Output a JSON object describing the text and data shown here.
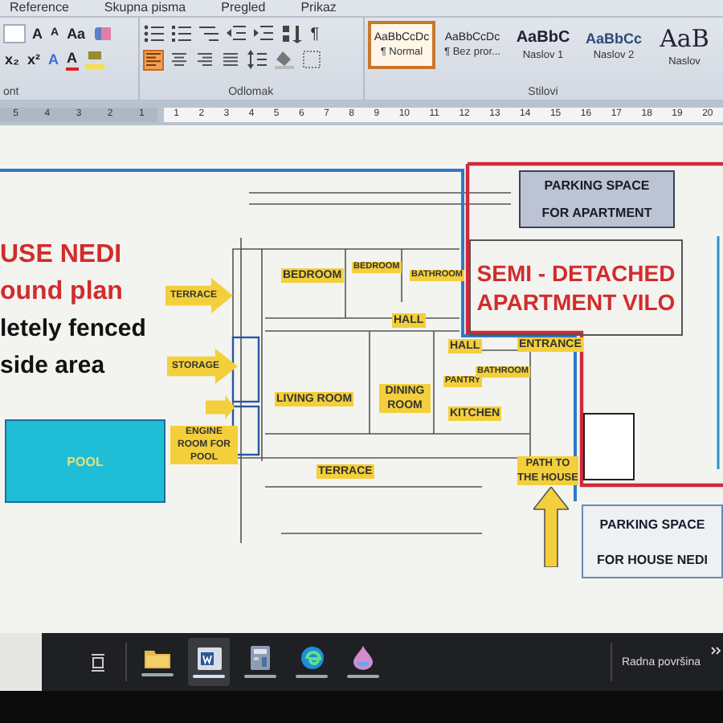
{
  "ribbon": {
    "tabs": [
      "Reference",
      "Skupna pisma",
      "Pregled",
      "Prikaz"
    ],
    "font_buttons": [
      {
        "label": "A",
        "kind": "grow"
      },
      {
        "label": "A",
        "kind": "shrink"
      },
      {
        "label": "Aa",
        "kind": "case"
      },
      {
        "label": "x₂",
        "kind": "sub"
      },
      {
        "label": "x²",
        "kind": "sup"
      },
      {
        "label": "A",
        "kind": "effects"
      },
      {
        "label": "A",
        "kind": "color"
      }
    ],
    "pilcrow": "¶",
    "align_buttons": [
      {
        "selected": true
      },
      {
        "selected": false
      },
      {
        "selected": false
      },
      {
        "selected": false
      }
    ],
    "groups": [
      "ont",
      "Odlomak",
      "Stilovi"
    ],
    "styles": [
      {
        "sample": "AaBbCcDc",
        "name": "¶ Normal",
        "selected": true,
        "kind": "body"
      },
      {
        "sample": "AaBbCcDc",
        "name": "¶ Bez pror...",
        "selected": false,
        "kind": "body"
      },
      {
        "sample": "AaBbC",
        "name": "Naslov 1",
        "selected": false,
        "kind": "heading"
      },
      {
        "sample": "AaBbCc",
        "name": "Naslov 2",
        "selected": false,
        "kind": "heading2"
      },
      {
        "sample": "AaB",
        "name": "Naslov",
        "selected": false,
        "kind": "title"
      }
    ]
  },
  "ruler": {
    "left_marks": [
      "5",
      "4",
      "3",
      "2",
      "1"
    ],
    "right_marks": [
      "1",
      "2",
      "3",
      "4",
      "5",
      "6",
      "7",
      "8",
      "9",
      "10",
      "11",
      "12",
      "13",
      "14",
      "15",
      "16",
      "17",
      "18",
      "19",
      "20"
    ]
  },
  "document": {
    "heading": [
      {
        "text": "USE NEDI",
        "kind": "red"
      },
      {
        "text": "ound plan",
        "kind": "red"
      },
      {
        "text": "letely fenced",
        "kind": "black"
      },
      {
        "text": "side area",
        "kind": "black"
      }
    ],
    "pool": "POOL",
    "arrows": [
      {
        "label": "TERRACE",
        "kind": "inside"
      },
      {
        "label": "STORAGE",
        "kind": "inside"
      },
      {
        "label": "ENGINE ROOM FOR POOL",
        "kind": "below"
      }
    ],
    "rooms": [
      "BEDROOM",
      "BEDROOM",
      "BATHROOM",
      "HALL",
      "HALL",
      "ENTRANCE",
      "LIVING ROOM",
      "DINING ROOM",
      "PANTRY",
      "BATHROOM",
      "KITCHEN",
      "TERRACE"
    ],
    "path_label": "PATH TO THE HOUSE",
    "semi_detached": [
      "SEMI - DETACHED",
      "APARTMENT VILO"
    ],
    "parking": [
      {
        "lines": [
          "PARKING SPACE",
          "FOR APARTMENT"
        ],
        "kind": "dark"
      },
      {
        "lines": [
          "PARKING SPACE",
          "FOR HOUSE NEDI"
        ],
        "kind": "light"
      }
    ]
  },
  "taskbar": {
    "apps": [
      {
        "kind": "folder",
        "selected": false
      },
      {
        "kind": "word",
        "selected": true
      },
      {
        "kind": "calculator",
        "selected": false
      },
      {
        "kind": "edge",
        "selected": false
      },
      {
        "kind": "drop",
        "selected": false
      }
    ],
    "desktop_label": "Radna površina"
  }
}
